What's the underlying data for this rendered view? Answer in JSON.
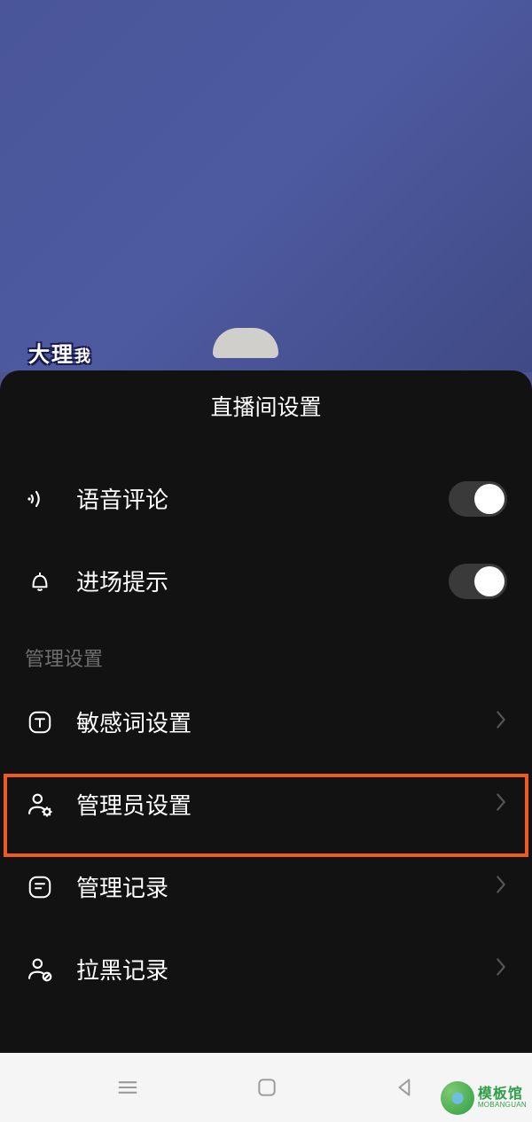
{
  "backdrop": {
    "partial_text": "大理…"
  },
  "panel": {
    "title": "直播间设置",
    "items_a": [
      {
        "icon": "voice-icon",
        "label": "语音评论",
        "kind": "toggle",
        "on": true
      },
      {
        "icon": "bell-icon",
        "label": "进场提示",
        "kind": "toggle",
        "on": true
      }
    ],
    "section_header": "管理设置",
    "items_b": [
      {
        "icon": "letter-t-icon",
        "label": "敏感词设置",
        "kind": "nav"
      },
      {
        "icon": "admin-person-icon",
        "label": "管理员设置",
        "kind": "nav",
        "highlighted": true
      },
      {
        "icon": "record-list-icon",
        "label": "管理记录",
        "kind": "nav"
      },
      {
        "icon": "blocked-person-icon",
        "label": "拉黑记录",
        "kind": "nav"
      }
    ]
  },
  "watermark": {
    "line1": "模板馆",
    "line2": "MOBANGUAN"
  }
}
